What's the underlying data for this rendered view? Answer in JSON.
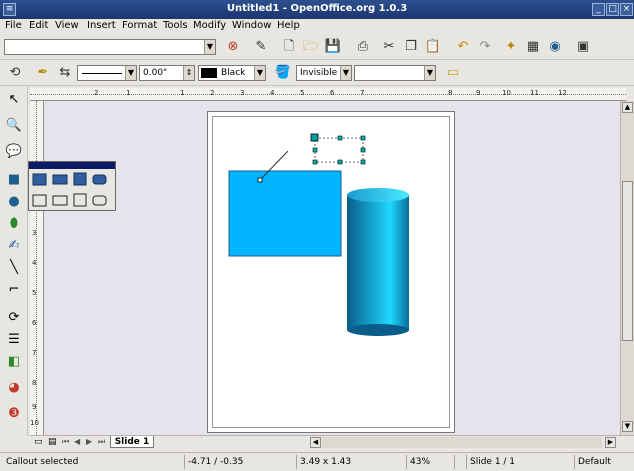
{
  "window": {
    "title": "Untitled1 - OpenOffice.org 1.0.3",
    "buttons": {
      "minimize": "_",
      "maximize": "□",
      "close": "×"
    }
  },
  "menubar": {
    "items": [
      {
        "label": "File",
        "mnemonic": "F"
      },
      {
        "label": "Edit",
        "mnemonic": "E"
      },
      {
        "label": "View",
        "mnemonic": "V"
      },
      {
        "label": "Insert",
        "mnemonic": "I"
      },
      {
        "label": "Format",
        "mnemonic": "r"
      },
      {
        "label": "Tools",
        "mnemonic": "T"
      },
      {
        "label": "Modify",
        "mnemonic": "M"
      },
      {
        "label": "Window",
        "mnemonic": "W"
      },
      {
        "label": "Help",
        "mnemonic": "H"
      }
    ]
  },
  "function_bar": {
    "url_value": ""
  },
  "object_bar": {
    "line_width": "0.00\"",
    "line_color": "Black",
    "area_style": "Invisible",
    "area_value": ""
  },
  "ruler": {
    "h_numbers": [
      "2",
      "1",
      "1",
      "2",
      "3",
      "4",
      "5",
      "6",
      "7",
      "8",
      "9",
      "10",
      "11",
      "12"
    ],
    "v_numbers": [
      "1",
      "2",
      "3",
      "4",
      "5",
      "6",
      "7",
      "8",
      "9",
      "10"
    ]
  },
  "tabs": {
    "slide_tab": "Slide 1"
  },
  "statusbar": {
    "status": "Callout selected",
    "position": "-4.71 / -0.35",
    "size": "3.49 x 1.43",
    "zoom": "43%",
    "slide": "Slide 1 / 1",
    "layout": "Default"
  },
  "colors": {
    "titlebar": "#1c3670",
    "rectangle_fill": "#00b4ff",
    "cylinder_light": "#20e0ff",
    "cylinder_dark": "#0a5d8a",
    "canvas_bg": "#e6e3ed"
  }
}
